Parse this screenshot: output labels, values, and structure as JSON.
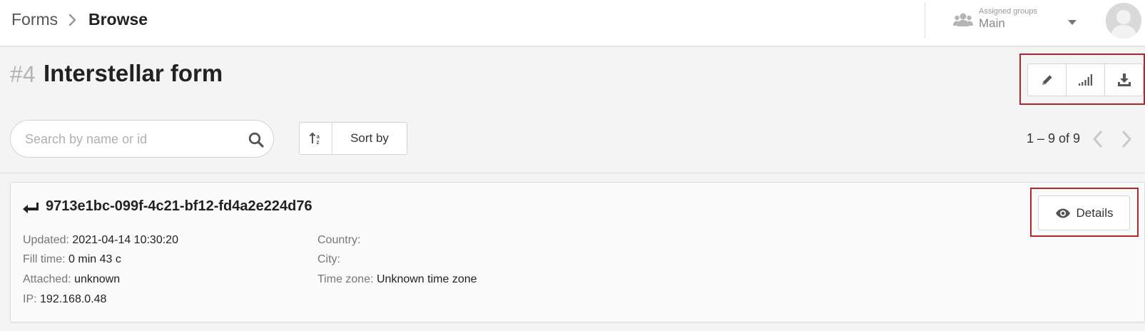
{
  "breadcrumb": {
    "root": "Forms",
    "current": "Browse"
  },
  "assigned_groups": {
    "caption": "Assigned groups",
    "value": "Main"
  },
  "form": {
    "number": "#4",
    "title": "Interstellar form"
  },
  "search": {
    "placeholder": "Search by name or id",
    "value": ""
  },
  "sort": {
    "label": "Sort by"
  },
  "pagination": {
    "text": "1 – 9 of 9"
  },
  "toolbar": {
    "icons": [
      "pencil-icon",
      "signal-bars-icon",
      "download-icon"
    ]
  },
  "submission": {
    "id": "9713e1bc-099f-4c21-bf12-fd4a2e224d76",
    "details_label": "Details",
    "fields_left": [
      {
        "label": "Updated:",
        "value": "2021-04-14 10:30:20"
      },
      {
        "label": "Fill time:",
        "value": "0 min 43 c"
      },
      {
        "label": "Attached:",
        "value": "unknown"
      },
      {
        "label": "IP:",
        "value": "192.168.0.48"
      }
    ],
    "fields_right": [
      {
        "label": "Country:",
        "value": ""
      },
      {
        "label": "City:",
        "value": ""
      },
      {
        "label": "Time zone:",
        "value": "Unknown time zone"
      }
    ]
  },
  "colors": {
    "highlight": "#b3262c",
    "icon": "#555555",
    "icon_muted": "#aaaaaa"
  }
}
